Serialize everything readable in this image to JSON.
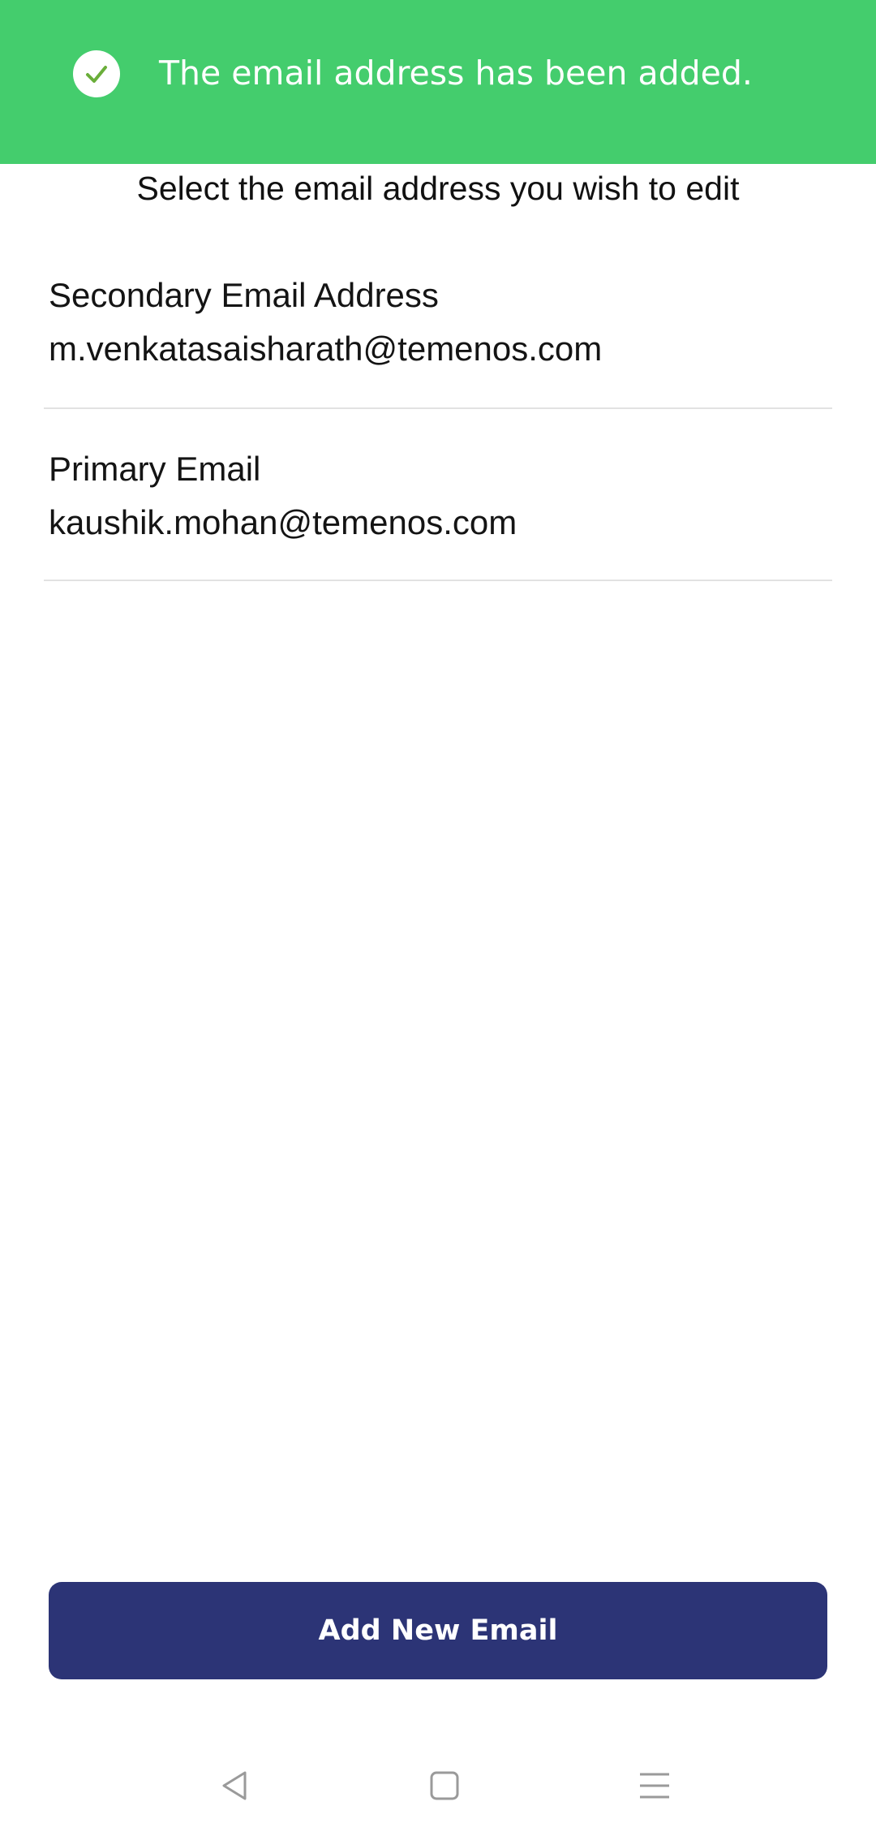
{
  "toast": {
    "message": "The email address has been added.",
    "icon": "check-circle-icon",
    "background": "#44cd6d",
    "icon_color": "#6aae3a"
  },
  "page": {
    "heading": "Select the email address you wish to edit"
  },
  "emails": [
    {
      "label": "Secondary Email Address",
      "address": "m.venkatasaisharath@temenos.com"
    },
    {
      "label": "Primary Email",
      "address": "kaushik.mohan@temenos.com"
    }
  ],
  "actions": {
    "add_label": "Add New Email",
    "button_color": "#2c3476"
  },
  "navbar": {
    "back_icon": "back-triangle-icon",
    "home_icon": "home-square-icon",
    "menu_icon": "menu-lines-icon"
  }
}
